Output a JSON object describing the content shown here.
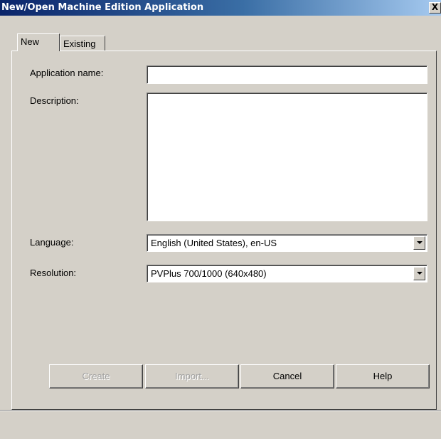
{
  "window": {
    "title": "New/Open Machine Edition Application",
    "close_glyph": "X"
  },
  "tabs": [
    {
      "label": "New",
      "selected": true
    },
    {
      "label": "Existing",
      "selected": false
    }
  ],
  "form": {
    "app_name_label": "Application name:",
    "app_name_value": "",
    "description_label": "Description:",
    "description_value": "",
    "language_label": "Language:",
    "language_value": "English (United States), en-US",
    "resolution_label": "Resolution:",
    "resolution_value": "PVPlus 700/1000 (640x480)"
  },
  "buttons": {
    "create": "Create",
    "import": "Import...",
    "cancel": "Cancel",
    "help": "Help"
  },
  "icons": {
    "close": "close-icon",
    "dropdown": "chevron-down-icon"
  },
  "colors": {
    "face": "#d4d0c8",
    "title_start": "#0a246a",
    "title_end": "#a6caf0",
    "disabled_text": "#a0a0a0"
  }
}
